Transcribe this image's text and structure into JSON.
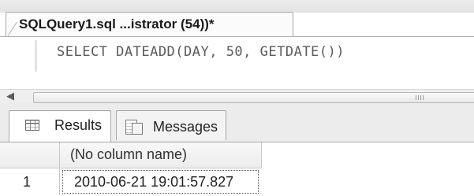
{
  "document_tab": {
    "title": "SQLQuery1.sql ...istrator (54))*"
  },
  "editor": {
    "code": "SELECT DATEADD(DAY, 50, GETDATE())"
  },
  "result_tabs": [
    {
      "label": "Results",
      "icon": "results-grid-icon",
      "selected": true
    },
    {
      "label": "Messages",
      "icon": "messages-icon",
      "selected": false
    }
  ],
  "results_grid": {
    "columns": [
      "(No column name)"
    ],
    "rows": [
      {
        "row_number": "1",
        "cells": [
          "2010-06-21 19:01:57.827"
        ]
      }
    ]
  },
  "colors": {
    "tab_border": "#a9a9a9",
    "code_text": "#5b5b5b",
    "panel_bg": "#ececec"
  }
}
